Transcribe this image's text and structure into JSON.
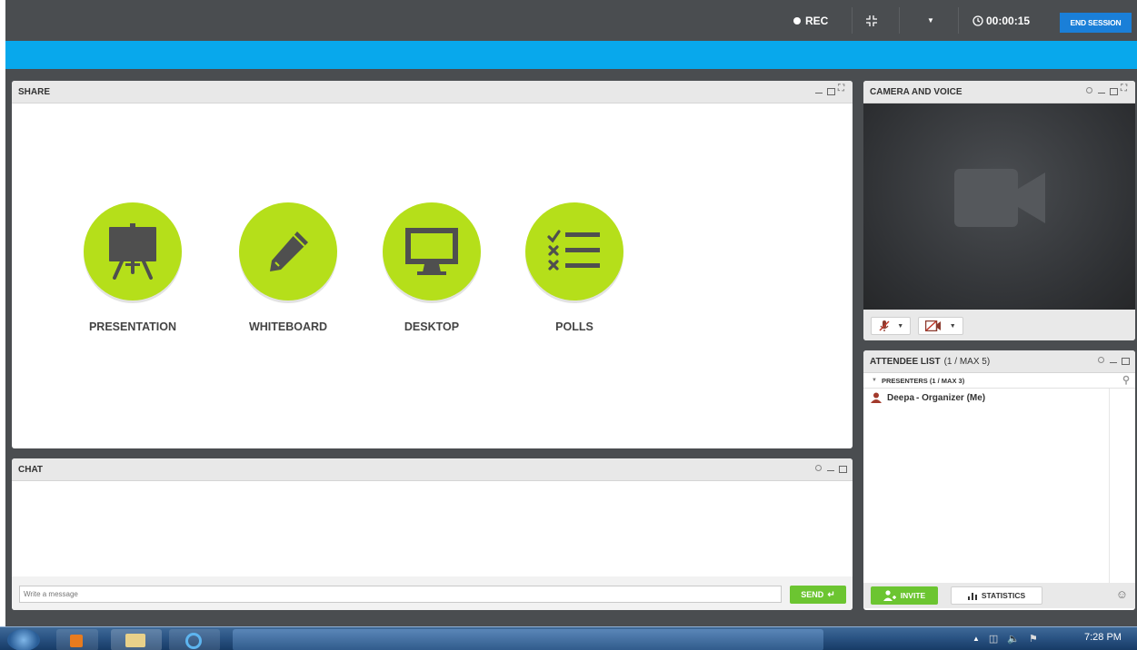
{
  "topbar": {
    "rec_label": "REC",
    "timer": "00:00:15",
    "end_session_label": "END SESSION"
  },
  "share": {
    "title": "SHARE",
    "tools": [
      {
        "label": "PRESENTATION",
        "icon": "presentation-easel-icon"
      },
      {
        "label": "WHITEBOARD",
        "icon": "pencil-icon"
      },
      {
        "label": "DESKTOP",
        "icon": "monitor-icon"
      },
      {
        "label": "POLLS",
        "icon": "poll-checklist-icon"
      }
    ]
  },
  "chat": {
    "title": "CHAT",
    "input_placeholder": "Write a message",
    "send_label": "SEND"
  },
  "camera": {
    "title": "CAMERA AND VOICE"
  },
  "attendees": {
    "title": "ATTENDEE LIST",
    "count": "(1 / MAX 5)",
    "presenters_label": "PRESENTERS (1 / MAX 3)",
    "list": [
      {
        "name": "Deepa",
        "role": " - Organizer (Me)"
      }
    ],
    "invite_label": "INVITE",
    "statistics_label": "STATISTICS"
  },
  "taskbar": {
    "clock": "7:28 PM"
  },
  "colors": {
    "accent_blue": "#08a8ec",
    "tool_green": "#b5df1a",
    "button_green": "#6cc531",
    "end_session_blue": "#1a7fd8",
    "chrome_gray": "#4a4d50"
  }
}
